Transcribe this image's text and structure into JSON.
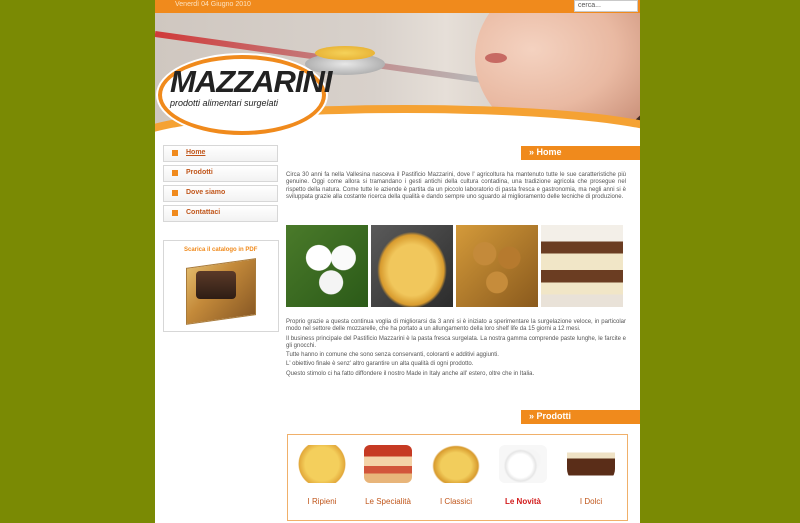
{
  "topbar": {
    "date": "Venerdì 04 Giugno 2010",
    "search_placeholder": "cerca..."
  },
  "logo": {
    "brand": "MAZZARINI",
    "tagline": "prodotti alimentari surgelati"
  },
  "nav": {
    "items": [
      {
        "label": "Home",
        "active": true
      },
      {
        "label": "Prodotti",
        "active": false
      },
      {
        "label": "Dove siamo",
        "active": false
      },
      {
        "label": "Contattaci",
        "active": false
      }
    ]
  },
  "catalog": {
    "title": "Scarica il catalogo in PDF"
  },
  "sections": {
    "home": "» Home",
    "prodotti": "» Prodotti"
  },
  "intro": "Circa 30 anni fa nella Vallesina nasceva il Pastificio Mazzarini, dove l' agricoltura ha mantenuto tutte le sue caratteristiche più genuine. Oggi come allora si tramandano i gesti antichi della cultura contadina, una tradizione agricola che prosegue nel rispetto della natura. Come tutte le aziende è partita da un piccolo laboratorio di pasta fresca e gastronomia, ma negli anni si è sviluppata grazie alla costante ricerca della qualità e dando sempre uno sguardo al miglioramento delle tecniche di produzione.",
  "body": [
    "Proprio grazie a questa continua voglia di migliorarsi da 3 anni si è iniziato a sperimentare la surgelazione veloce, in particolar modo nel settore delle mozzarelle, che ha portato a un allungamento della loro shelf life da 15 giorni a 12 mesi.",
    "Il business principale del Pastificio Mazzarini è la pasta fresca surgelata. La nostra gamma comprende paste lunghe, le farcite e gli gnocchi.",
    "Tutte hanno in comune che sono senza conservanti, coloranti e additivi aggiunti.",
    "L' obiettivo finale è senz' altro garantire un alta qualità di ogni prodotto.",
    "Questo stimolo ci ha fatto diffondere il nostro Made in Italy anche all' estero, oltre che in Italia."
  ],
  "products": [
    {
      "label": "I Ripieni",
      "highlight": false
    },
    {
      "label": "Le Specialità",
      "highlight": false
    },
    {
      "label": "I Classici",
      "highlight": false
    },
    {
      "label": "Le Novità",
      "highlight": true
    },
    {
      "label": "I Dolci",
      "highlight": false
    }
  ],
  "colors": {
    "background": "#7a8a04",
    "accent": "#f08a1c",
    "link": "#c0561b",
    "highlight": "#d21b1b"
  }
}
